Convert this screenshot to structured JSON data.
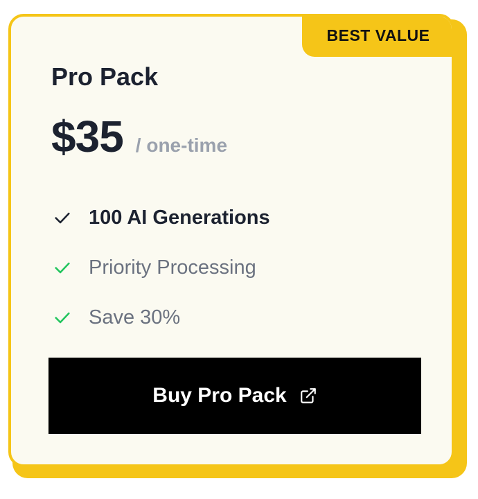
{
  "card": {
    "badge": "BEST VALUE",
    "title": "Pro Pack",
    "price": "$35",
    "period": "/ one-time",
    "features": [
      {
        "label": "100 AI Generations",
        "icon": "check-icon",
        "emphasis": true
      },
      {
        "label": "Priority Processing",
        "icon": "check-icon",
        "emphasis": false
      },
      {
        "label": "Save 30%",
        "icon": "check-icon",
        "emphasis": false
      }
    ],
    "button_label": "Buy Pro Pack",
    "button_icon": "external-link-icon"
  },
  "colors": {
    "accent": "#f5c518",
    "card_bg": "#fbfaf1",
    "check_dark": "#1c2230",
    "check_green": "#22c55e",
    "button_bg": "#000000"
  }
}
